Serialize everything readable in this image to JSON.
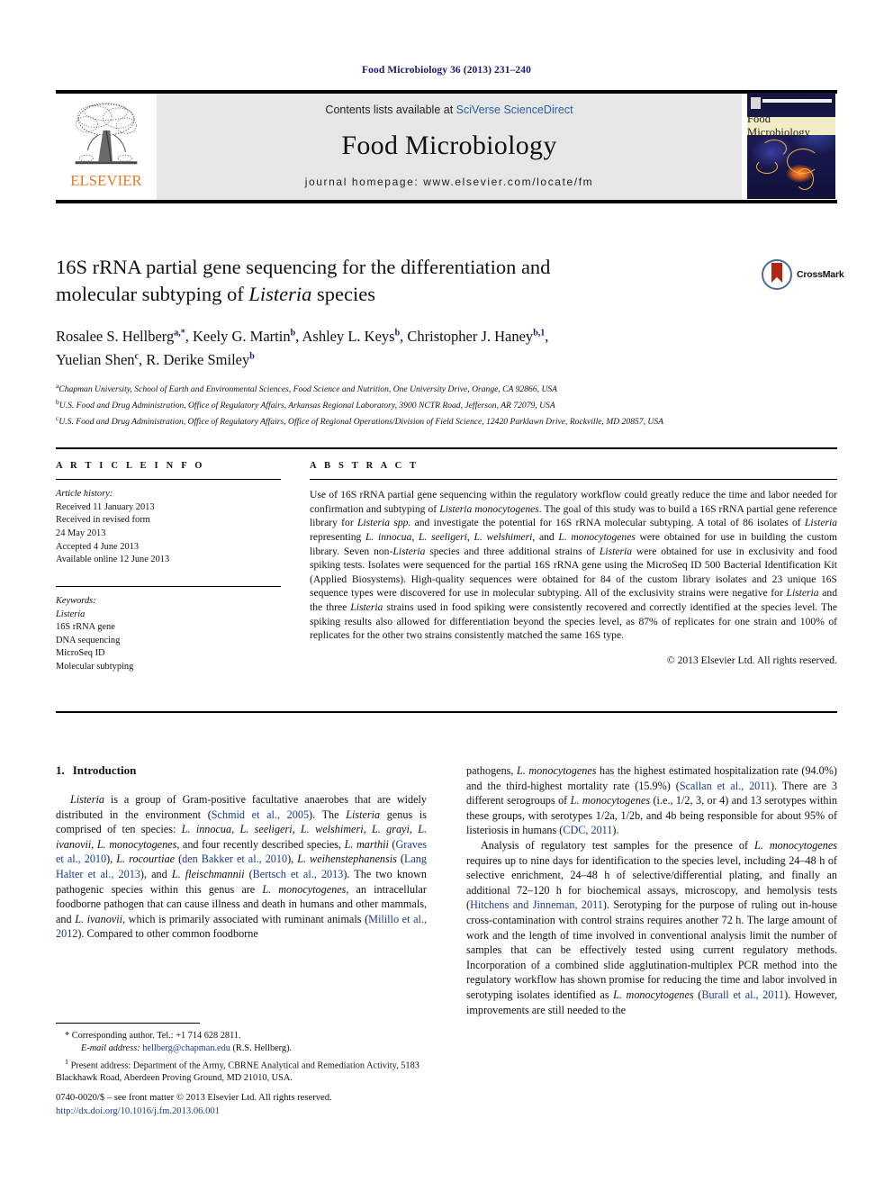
{
  "running_head": "Food Microbiology 36 (2013) 231–240",
  "masthead": {
    "publisher": "ELSEVIER",
    "contents_prefix": "Contents lists available at ",
    "contents_link": "SciVerse ScienceDirect",
    "journal_title": "Food Microbiology",
    "homepage": "journal homepage: www.elsevier.com/locate/fm",
    "cover_title": "Food Microbiology"
  },
  "crossmark": {
    "label": "CrossMark"
  },
  "article": {
    "title_line1": "16S rRNA partial gene sequencing for the differentiation and",
    "title_line2_pre": "molecular subtyping of ",
    "title_line2_italic": "Listeria",
    "title_line2_post": " species",
    "authors": [
      {
        "name": "Rosalee S. Hellberg",
        "sup": "a,*",
        "sep": ", "
      },
      {
        "name": "Keely G. Martin",
        "sup": "b",
        "sep": ", "
      },
      {
        "name": "Ashley L. Keys",
        "sup": "b",
        "sep": ", "
      },
      {
        "name": "Christopher J. Haney",
        "sup": "b,1",
        "sep": ", "
      },
      {
        "name": "Yuelian Shen",
        "sup": "c",
        "sep": ", "
      },
      {
        "name": "R. Derike Smiley",
        "sup": "b",
        "sep": ""
      }
    ],
    "affiliations": [
      {
        "label": "a",
        "text": "Chapman University, School of Earth and Environmental Sciences, Food Science and Nutrition, One University Drive, Orange, CA 92866, USA"
      },
      {
        "label": "b",
        "text": "U.S. Food and Drug Administration, Office of Regulatory Affairs, Arkansas Regional Laboratory, 3900 NCTR Road, Jefferson, AR 72079, USA"
      },
      {
        "label": "c",
        "text": "U.S. Food and Drug Administration, Office of Regulatory Affairs, Office of Regional Operations/Division of Field Science, 12420 Parklawn Drive, Rockville, MD 20857, USA"
      }
    ]
  },
  "article_info": {
    "heading": "A R T I C L E   I N F O",
    "history_label": "Article history:",
    "history": [
      "Received 11 January 2013",
      "Received in revised form",
      "24 May 2013",
      "Accepted 4 June 2013",
      "Available online 12 June 2013"
    ],
    "keywords_label": "Keywords:",
    "keywords": [
      "Listeria",
      "16S rRNA gene",
      "DNA sequencing",
      "MicroSeq ID",
      "Molecular subtyping"
    ]
  },
  "abstract": {
    "heading": "A B S T R A C T",
    "text": "Use of 16S rRNA partial gene sequencing within the regulatory workflow could greatly reduce the time and labor needed for confirmation and subtyping of Listeria monocytogenes. The goal of this study was to build a 16S rRNA partial gene reference library for Listeria spp. and investigate the potential for 16S rRNA molecular subtyping. A total of 86 isolates of Listeria representing L. innocua, L. seeligeri, L. welshimeri, and L. monocytogenes were obtained for use in building the custom library. Seven non-Listeria species and three additional strains of Listeria were obtained for use in exclusivity and food spiking tests. Isolates were sequenced for the partial 16S rRNA gene using the MicroSeq ID 500 Bacterial Identification Kit (Applied Biosystems). High-quality sequences were obtained for 84 of the custom library isolates and 23 unique 16S sequence types were discovered for use in molecular subtyping. All of the exclusivity strains were negative for Listeria and the three Listeria strains used in food spiking were consistently recovered and correctly identified at the species level. The spiking results also allowed for differentiation beyond the species level, as 87% of replicates for one strain and 100% of replicates for the other two strains consistently matched the same 16S type.",
    "copyright": "© 2013 Elsevier Ltd. All rights reserved."
  },
  "introduction": {
    "number": "1.",
    "heading": "Introduction",
    "paragraph_1": "Listeria is a group of Gram-positive facultative anaerobes that are widely distributed in the environment (Schmid et al., 2005). The Listeria genus is comprised of ten species: L. innocua, L. seeligeri, L. welshimeri, L. grayi, L. ivanovii, L. monocytogenes, and four recently described species, L. marthii (Graves et al., 2010), L. rocourtiae (den Bakker et al., 2010), L. weihenstephanensis (Lang Halter et al., 2013), and L. fleischmannii (Bertsch et al., 2013). The two known pathogenic species within this genus are L. monocytogenes, an intracellular foodborne pathogen that can cause illness and death in humans and other mammals, and L. ivanovii, which is primarily associated with ruminant animals (Milillo et al., 2012). Compared to other common foodborne pathogens, L. monocytogenes has the highest estimated hospitalization rate (94.0%) and the third-highest mortality rate (15.9%) (Scallan et al., 2011). There are 3 different serogroups of L. monocytogenes (i.e., 1/2, 3, or 4) and 13 serotypes within these groups, with serotypes 1/2a, 1/2b, and 4b being responsible for about 95% of listeriosis in humans (CDC, 2011).",
    "paragraph_2": "Analysis of regulatory test samples for the presence of L. monocytogenes requires up to nine days for identification to the species level, including 24–48 h of selective enrichment, 24–48 h of selective/differential plating, and finally an additional 72–120 h for biochemical assays, microscopy, and hemolysis tests (Hitchens and Jinneman, 2011). Serotyping for the purpose of ruling out in-house cross-contamination with control strains requires another 72 h. The large amount of work and the length of time involved in conventional analysis limit the number of samples that can be effectively tested using current regulatory methods. Incorporation of a combined slide agglutination-multiplex PCR method into the regulatory workflow has shown promise for reducing the time and labor involved in serotyping isolates identified as L. monocytogenes (Burall et al., 2011). However, improvements are still needed to the"
  },
  "footnotes": {
    "corresponding": "* Corresponding author. Tel.: +1 714 628 2811.",
    "email_label": "E-mail address:",
    "email": "hellberg@chapman.edu",
    "email_suffix": " (R.S. Hellberg).",
    "present_address_marker": "1",
    "present_address": "Present address: Department of the Army, CBRNE Analytical and Remediation Activity, 5183 Blackhawk Road, Aberdeen Proving Ground, MD 21010, USA."
  },
  "frontmatter": {
    "line1": "0740-0020/$ – see front matter © 2013 Elsevier Ltd. All rights reserved.",
    "doi": "http://dx.doi.org/10.1016/j.fm.2013.06.001"
  },
  "colors": {
    "link": "#1a3a8f",
    "elsevier_orange": "#e87722",
    "band_gray": "#e6e6e6",
    "crossmark_red": "#b5260f",
    "crossmark_blue": "#4a6b9a"
  }
}
